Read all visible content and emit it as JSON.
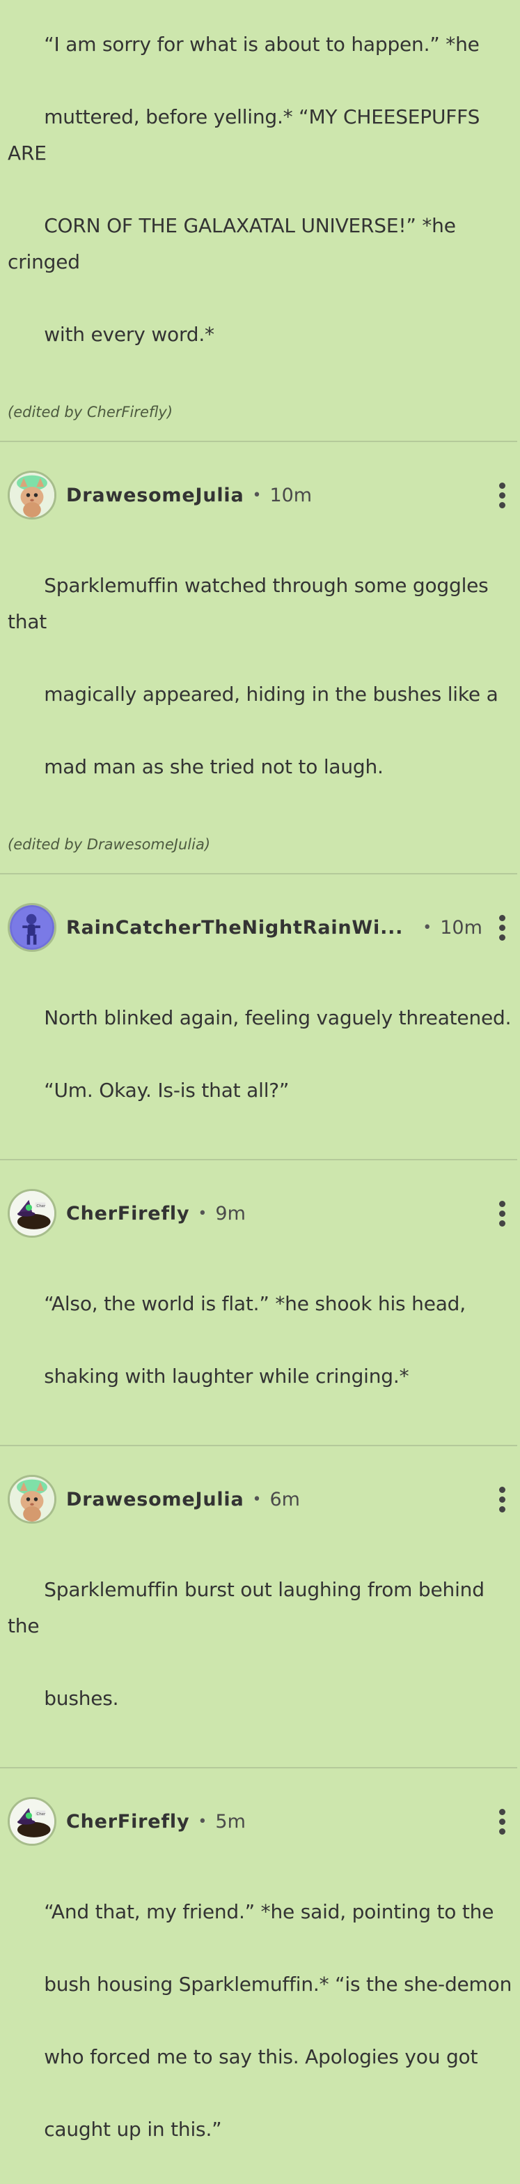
{
  "top_post": {
    "lines": [
      "“I am sorry for what is about to happen.” *he",
      "muttered, before yelling.* “MY CHEESEPUFFS ARE",
      "CORN OF THE GALAXATAL UNIVERSE!” *he cringed",
      "with every word.*"
    ],
    "edited": "(edited by CherFirefly)"
  },
  "posts": [
    {
      "username": "DrawesomeJulia",
      "separator": "•",
      "time": "10m",
      "lines": [
        "Sparklemuffin watched through some goggles that",
        "magically appeared, hiding in the bushes like a",
        "mad man as she tried not to laugh."
      ],
      "edited": "(edited by DrawesomeJulia)"
    },
    {
      "username": "RainCatcherTheNightRainWi...",
      "separator": "•",
      "time": "10m",
      "lines": [
        "North blinked again, feeling vaguely threatened.",
        "“Um. Okay. Is-is that all?”"
      ]
    },
    {
      "username": "CherFirefly",
      "separator": "•",
      "time": "9m",
      "lines": [
        "“Also, the world is flat.” *he shook his head,",
        "shaking with laughter while cringing.*"
      ]
    },
    {
      "username": "DrawesomeJulia",
      "separator": "•",
      "time": "6m",
      "lines": [
        "Sparklemuffin burst out laughing from behind the",
        "bushes."
      ]
    },
    {
      "username": "CherFirefly",
      "separator": "•",
      "time": "5m",
      "lines": [
        "“And that, my friend.” *he said, pointing to the",
        "bush housing Sparklemuffin.* “is the she-demon",
        "who forced me to say this. Apologies you got",
        "caught up in this.”"
      ]
    }
  ],
  "icons": {
    "menu": "more-vertical-icon",
    "avatar_drawesome": "cat-avatar",
    "avatar_rain": "blue-figure-avatar",
    "avatar_cher": "witch-hat-avatar"
  },
  "colors": {
    "background": "#cde6ad",
    "text": "#333333",
    "divider": "#b4c99a"
  }
}
